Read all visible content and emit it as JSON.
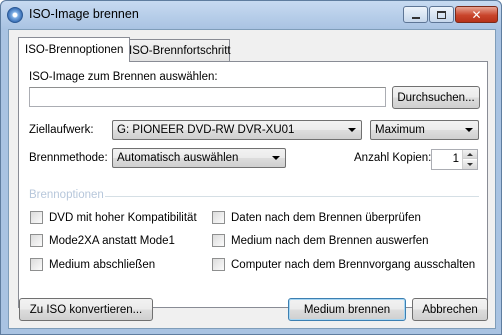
{
  "window": {
    "title": "ISO-Image brennen"
  },
  "tabs": [
    {
      "label": "ISO-Brennoptionen"
    },
    {
      "label": "ISO-Brennfortschritt"
    }
  ],
  "iso_select": {
    "label": "ISO-Image zum Brennen auswählen:",
    "path_value": "",
    "browse_label": "Durchsuchen..."
  },
  "target_drive": {
    "label": "Ziellaufwerk:",
    "selected": "G: PIONEER DVD-RW  DVR-XU01",
    "speed_selected": "Maximum"
  },
  "burn_method": {
    "label": "Brennmethode:",
    "selected": "Automatisch auswählen"
  },
  "copies": {
    "label": "Anzahl Kopien:",
    "value": "1"
  },
  "options_group": {
    "label": "Brennoptionen",
    "left": [
      {
        "label": "DVD mit hoher Kompatibilität",
        "checked": false
      },
      {
        "label": "Mode2XA anstatt Mode1",
        "checked": false
      },
      {
        "label": "Medium abschließen",
        "checked": false
      }
    ],
    "right": [
      {
        "label": "Daten nach dem Brennen überprüfen",
        "checked": false
      },
      {
        "label": "Medium nach dem Brennen auswerfen",
        "checked": false
      },
      {
        "label": "Computer nach dem Brennvorgang ausschalten",
        "checked": false
      }
    ]
  },
  "footer": {
    "convert_label": "Zu ISO konvertieren...",
    "burn_label": "Medium brennen",
    "cancel_label": "Abbrechen"
  }
}
